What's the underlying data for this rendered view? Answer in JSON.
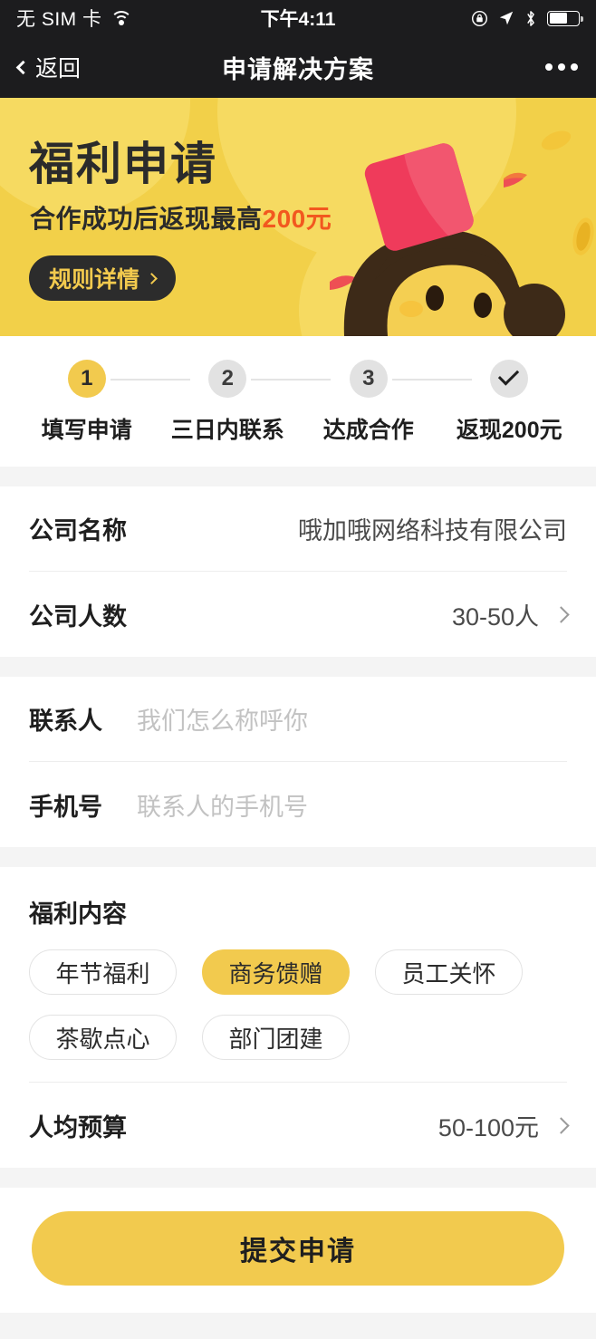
{
  "status_bar": {
    "carrier": "无 SIM 卡",
    "wifi_icon": "wifi-icon",
    "time": "下午4:11",
    "rotation_lock_icon": "rotation-lock-icon",
    "location_icon": "location-arrow-icon",
    "bluetooth_icon": "bluetooth-icon",
    "battery_icon": "battery-icon",
    "battery_level_pct": 62
  },
  "nav": {
    "back_label": "返回",
    "back_icon": "chevron-left-icon",
    "title": "申请解决方案",
    "more_icon": "more-horizontal-icon"
  },
  "banner": {
    "title": "福利申请",
    "subtitle_prefix": "合作成功后返现最高",
    "subtitle_highlight": "200元",
    "rule_button_label": "规则详情",
    "rule_button_icon": "chevron-right-icon",
    "bg_color": "#F2D049",
    "highlight_color": "#F2581F",
    "button_bg": "#2C2C2C",
    "button_text_color": "#F2CA4E",
    "illustration": "mascot-with-red-envelope-illustration"
  },
  "stepper": {
    "active_color": "#F2CA4E",
    "inactive_color": "#E2E2E2",
    "steps": [
      {
        "marker": "1",
        "label": "填写申请",
        "state": "active"
      },
      {
        "marker": "2",
        "label": "三日内联系",
        "state": "inactive"
      },
      {
        "marker": "3",
        "label": "达成合作",
        "state": "inactive"
      },
      {
        "marker": "check",
        "label": "返现200元",
        "state": "inactive"
      }
    ]
  },
  "form": {
    "company_section": [
      {
        "label": "公司名称",
        "value": "哦加哦网络科技有限公司",
        "placeholder": "",
        "has_arrow": false,
        "is_placeholder": false
      },
      {
        "label": "公司人数",
        "value": "30-50人",
        "placeholder": "",
        "has_arrow": true,
        "is_placeholder": false
      }
    ],
    "contact_section": [
      {
        "label": "联系人",
        "value": "",
        "placeholder": "我们怎么称呼你",
        "has_arrow": false,
        "is_placeholder": true
      },
      {
        "label": "手机号",
        "value": "",
        "placeholder": "联系人的手机号",
        "has_arrow": false,
        "is_placeholder": true
      }
    ],
    "benefit_section": {
      "title": "福利内容",
      "tags": [
        {
          "label": "年节福利",
          "selected": false
        },
        {
          "label": "商务馈赠",
          "selected": true
        },
        {
          "label": "员工关怀",
          "selected": false
        },
        {
          "label": "茶歇点心",
          "selected": false
        },
        {
          "label": "部门团建",
          "selected": false
        }
      ],
      "budget_row": {
        "label": "人均预算",
        "value": "50-100元",
        "has_arrow": true
      }
    }
  },
  "submit": {
    "label": "提交申请",
    "bg_color": "#F2CA4E"
  }
}
